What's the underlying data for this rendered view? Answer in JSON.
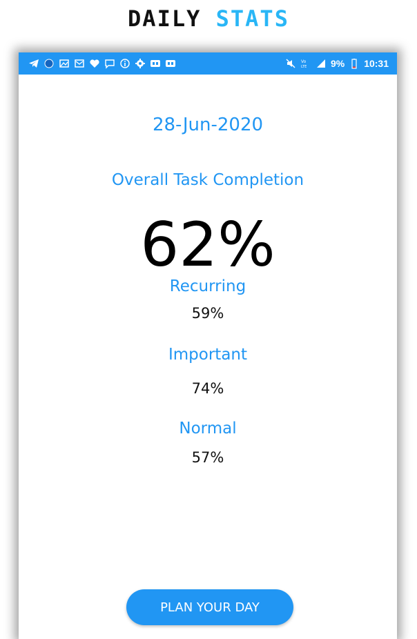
{
  "promo": {
    "title_part1": "DAILY",
    "title_part2": "STATS"
  },
  "colors": {
    "accent": "#2196f3",
    "promo_accent": "#29b6f6",
    "text": "#111111"
  },
  "status_bar": {
    "left_icons": [
      "telegram-icon",
      "circle-icon",
      "image-icon",
      "mail-icon",
      "heart-icon",
      "chat-icon",
      "info-icon",
      "settings-icon",
      "app-badge-icon",
      "app-badge-icon"
    ],
    "right_icons": [
      "mute-icon",
      "volte-icon",
      "signal-icon",
      "battery-icon"
    ],
    "battery": "9%",
    "time": "10:31"
  },
  "stats": {
    "date": "28-Jun-2020",
    "overall_label": "Overall Task Completion",
    "overall_value": "62%",
    "categories": [
      {
        "label": "Recurring",
        "value": "59%"
      },
      {
        "label": "Important",
        "value": "74%"
      },
      {
        "label": "Normal",
        "value": "57%"
      }
    ]
  },
  "actions": {
    "plan_label": "PLAN YOUR DAY"
  }
}
